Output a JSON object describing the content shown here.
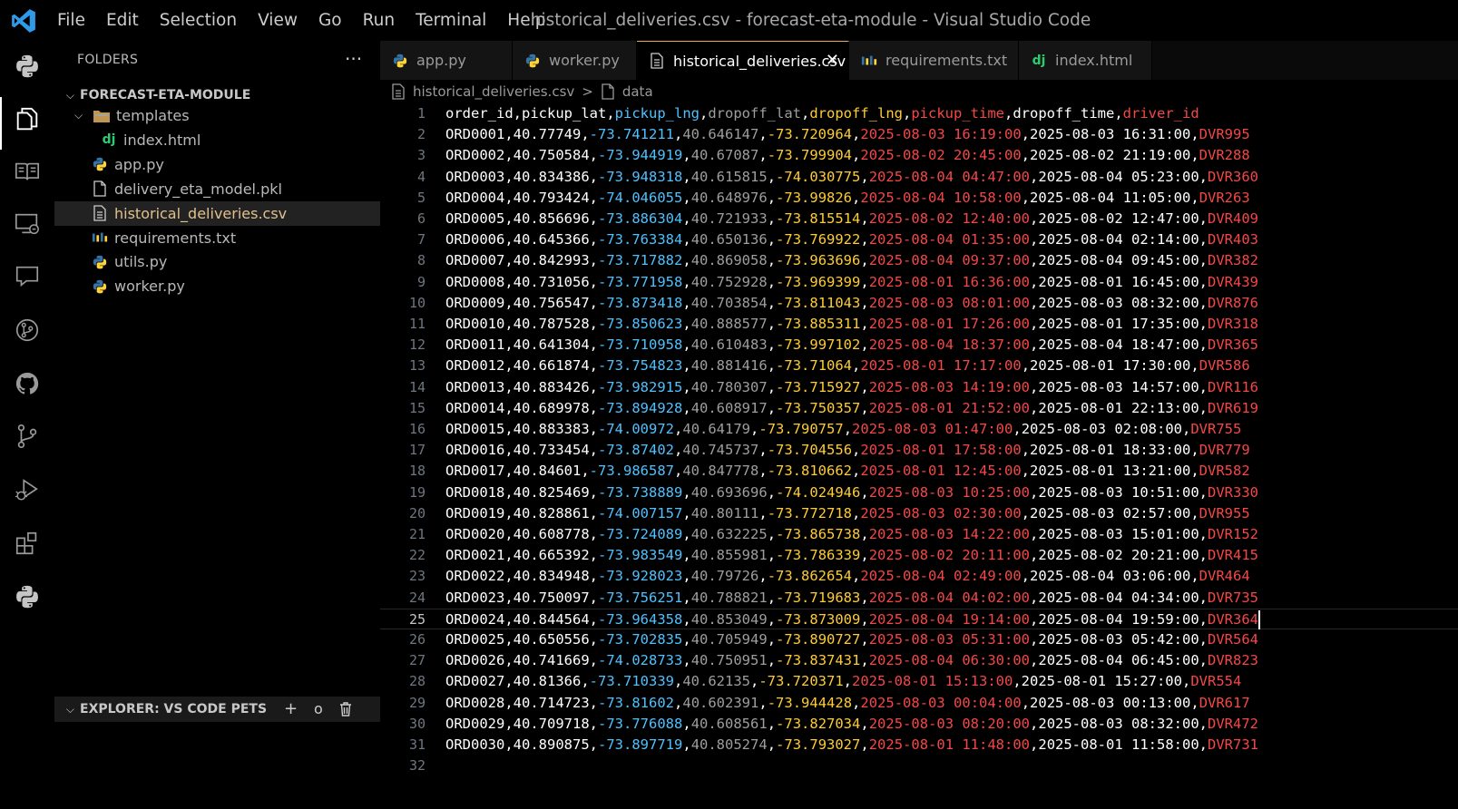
{
  "window": {
    "title": "historical_deliveries.csv - forecast-eta-module - Visual Studio Code"
  },
  "menu": [
    "File",
    "Edit",
    "Selection",
    "View",
    "Go",
    "Run",
    "Terminal",
    "Help"
  ],
  "activity_bar": [
    {
      "name": "python-icon"
    },
    {
      "name": "explorer-icon",
      "active": true
    },
    {
      "name": "book-icon"
    },
    {
      "name": "remote-explorer-icon"
    },
    {
      "name": "comments-icon"
    },
    {
      "name": "git-graph-icon"
    },
    {
      "name": "github-icon"
    },
    {
      "name": "source-control-icon"
    },
    {
      "name": "run-debug-icon"
    },
    {
      "name": "extensions-icon"
    },
    {
      "name": "python-icon"
    }
  ],
  "sidebar": {
    "title": "FOLDERS",
    "folder": "FORECAST-ETA-MODULE",
    "tree": [
      {
        "label": "templates",
        "type": "folder",
        "depth": 1,
        "expanded": true
      },
      {
        "label": "index.html",
        "type": "django",
        "depth": 2
      },
      {
        "label": "app.py",
        "type": "python",
        "depth": 1
      },
      {
        "label": "delivery_eta_model.pkl",
        "type": "file",
        "depth": 1
      },
      {
        "label": "historical_deliveries.csv",
        "type": "csv",
        "depth": 1,
        "selected": true
      },
      {
        "label": "requirements.txt",
        "type": "requirements",
        "depth": 1
      },
      {
        "label": "utils.py",
        "type": "python",
        "depth": 1
      },
      {
        "label": "worker.py",
        "type": "python",
        "depth": 1
      }
    ],
    "pets_title": "EXPLORER: VS CODE PETS",
    "pets_actions": [
      "+",
      "o",
      "trash-icon"
    ]
  },
  "tabs": [
    {
      "label": "app.py",
      "icon": "python"
    },
    {
      "label": "worker.py",
      "icon": "python"
    },
    {
      "label": "historical_deliveries.csv",
      "icon": "csv",
      "active": true
    },
    {
      "label": "requirements.txt",
      "icon": "requirements"
    },
    {
      "label": "index.html",
      "icon": "django"
    }
  ],
  "breadcrumb": {
    "file": "historical_deliveries.csv",
    "separator": ">",
    "section": "data"
  },
  "editor": {
    "cursor_line": 25,
    "header": [
      "order_id",
      "pickup_lat",
      "pickup_lng",
      "dropoff_lat",
      "dropoff_lng",
      "pickup_time",
      "dropoff_time",
      "driver_id"
    ],
    "rows": [
      [
        "ORD0001",
        "40.77749",
        "-73.741211",
        "40.646147",
        "-73.720964",
        "2025-08-03 16:19:00",
        "2025-08-03 16:31:00",
        "DVR995"
      ],
      [
        "ORD0002",
        "40.750584",
        "-73.944919",
        "40.67087",
        "-73.799904",
        "2025-08-02 20:45:00",
        "2025-08-02 21:19:00",
        "DVR288"
      ],
      [
        "ORD0003",
        "40.834386",
        "-73.948318",
        "40.615815",
        "-74.030775",
        "2025-08-04 04:47:00",
        "2025-08-04 05:23:00",
        "DVR360"
      ],
      [
        "ORD0004",
        "40.793424",
        "-74.046055",
        "40.648976",
        "-73.99826",
        "2025-08-04 10:58:00",
        "2025-08-04 11:05:00",
        "DVR263"
      ],
      [
        "ORD0005",
        "40.856696",
        "-73.886304",
        "40.721933",
        "-73.815514",
        "2025-08-02 12:40:00",
        "2025-08-02 12:47:00",
        "DVR409"
      ],
      [
        "ORD0006",
        "40.645366",
        "-73.763384",
        "40.650136",
        "-73.769922",
        "2025-08-04 01:35:00",
        "2025-08-04 02:14:00",
        "DVR403"
      ],
      [
        "ORD0007",
        "40.842993",
        "-73.717882",
        "40.869058",
        "-73.963696",
        "2025-08-04 09:37:00",
        "2025-08-04 09:45:00",
        "DVR382"
      ],
      [
        "ORD0008",
        "40.731056",
        "-73.771958",
        "40.752928",
        "-73.969399",
        "2025-08-01 16:36:00",
        "2025-08-01 16:45:00",
        "DVR439"
      ],
      [
        "ORD0009",
        "40.756547",
        "-73.873418",
        "40.703854",
        "-73.811043",
        "2025-08-03 08:01:00",
        "2025-08-03 08:32:00",
        "DVR876"
      ],
      [
        "ORD0010",
        "40.787528",
        "-73.850623",
        "40.888577",
        "-73.885311",
        "2025-08-01 17:26:00",
        "2025-08-01 17:35:00",
        "DVR318"
      ],
      [
        "ORD0011",
        "40.641304",
        "-73.710958",
        "40.610483",
        "-73.997102",
        "2025-08-04 18:37:00",
        "2025-08-04 18:47:00",
        "DVR365"
      ],
      [
        "ORD0012",
        "40.661874",
        "-73.754823",
        "40.881416",
        "-73.71064",
        "2025-08-01 17:17:00",
        "2025-08-01 17:30:00",
        "DVR586"
      ],
      [
        "ORD0013",
        "40.883426",
        "-73.982915",
        "40.780307",
        "-73.715927",
        "2025-08-03 14:19:00",
        "2025-08-03 14:57:00",
        "DVR116"
      ],
      [
        "ORD0014",
        "40.689978",
        "-73.894928",
        "40.608917",
        "-73.750357",
        "2025-08-01 21:52:00",
        "2025-08-01 22:13:00",
        "DVR619"
      ],
      [
        "ORD0015",
        "40.883383",
        "-74.00972",
        "40.64179",
        "-73.790757",
        "2025-08-03 01:47:00",
        "2025-08-03 02:08:00",
        "DVR755"
      ],
      [
        "ORD0016",
        "40.733454",
        "-73.87402",
        "40.745737",
        "-73.704556",
        "2025-08-01 17:58:00",
        "2025-08-01 18:33:00",
        "DVR779"
      ],
      [
        "ORD0017",
        "40.84601",
        "-73.986587",
        "40.847778",
        "-73.810662",
        "2025-08-01 12:45:00",
        "2025-08-01 13:21:00",
        "DVR582"
      ],
      [
        "ORD0018",
        "40.825469",
        "-73.738889",
        "40.693696",
        "-74.024946",
        "2025-08-03 10:25:00",
        "2025-08-03 10:51:00",
        "DVR330"
      ],
      [
        "ORD0019",
        "40.828861",
        "-74.007157",
        "40.80111",
        "-73.772718",
        "2025-08-03 02:30:00",
        "2025-08-03 02:57:00",
        "DVR955"
      ],
      [
        "ORD0020",
        "40.608778",
        "-73.724089",
        "40.632225",
        "-73.865738",
        "2025-08-03 14:22:00",
        "2025-08-03 15:01:00",
        "DVR152"
      ],
      [
        "ORD0021",
        "40.665392",
        "-73.983549",
        "40.855981",
        "-73.786339",
        "2025-08-02 20:11:00",
        "2025-08-02 20:21:00",
        "DVR415"
      ],
      [
        "ORD0022",
        "40.834948",
        "-73.928023",
        "40.79726",
        "-73.862654",
        "2025-08-04 02:49:00",
        "2025-08-04 03:06:00",
        "DVR464"
      ],
      [
        "ORD0023",
        "40.750097",
        "-73.756251",
        "40.788821",
        "-73.719683",
        "2025-08-04 04:02:00",
        "2025-08-04 04:34:00",
        "DVR735"
      ],
      [
        "ORD0024",
        "40.844564",
        "-73.964358",
        "40.853049",
        "-73.873009",
        "2025-08-04 19:14:00",
        "2025-08-04 19:59:00",
        "DVR364"
      ],
      [
        "ORD0025",
        "40.650556",
        "-73.702835",
        "40.705949",
        "-73.890727",
        "2025-08-03 05:31:00",
        "2025-08-03 05:42:00",
        "DVR564"
      ],
      [
        "ORD0026",
        "40.741669",
        "-74.028733",
        "40.750951",
        "-73.837431",
        "2025-08-04 06:30:00",
        "2025-08-04 06:45:00",
        "DVR823"
      ],
      [
        "ORD0027",
        "40.81366",
        "-73.710339",
        "40.62135",
        "-73.720371",
        "2025-08-01 15:13:00",
        "2025-08-01 15:27:00",
        "DVR554"
      ],
      [
        "ORD0028",
        "40.714723",
        "-73.81602",
        "40.602391",
        "-73.944428",
        "2025-08-03 00:04:00",
        "2025-08-03 00:13:00",
        "DVR617"
      ],
      [
        "ORD0029",
        "40.709718",
        "-73.776088",
        "40.608561",
        "-73.827034",
        "2025-08-03 08:20:00",
        "2025-08-03 08:32:00",
        "DVR472"
      ],
      [
        "ORD0030",
        "40.890875",
        "-73.897719",
        "40.805274",
        "-73.793027",
        "2025-08-01 11:48:00",
        "2025-08-01 11:58:00",
        "DVR731"
      ]
    ],
    "trailing_line_count": 1
  },
  "colors": {
    "background": "#000000",
    "accent_tab_top": "#e8ab53",
    "selected_file": "#e2c08d",
    "col_1": "#ffffff",
    "col_2": "#4fc1ff",
    "col_3": "#9e9e9e",
    "col_4": "#ffcc33",
    "col_5": "#f44747",
    "col_6": "#ffffff",
    "col_7": "#f44747"
  }
}
